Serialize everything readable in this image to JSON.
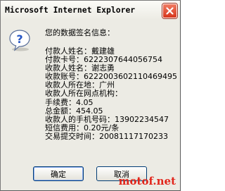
{
  "window": {
    "title": "Microsoft Internet Explorer"
  },
  "dialog": {
    "icon": "question-icon",
    "heading": "您的数据签名信息：",
    "lines": [
      "付款人姓名：戴建雄",
      "付款卡号：6222307644056754",
      "收款人姓名：谢志勇",
      "收款账号：6222003602110469495",
      "收款人所在地：广州",
      "收款人所在网点机构：",
      "手续费：4.05",
      "总金额：454.05",
      "收款人的手机号码：13902234547",
      "短信费用：0.20元/条",
      "交易提交时间：20081117170233"
    ]
  },
  "buttons": {
    "ok": "确定",
    "cancel": "取消"
  },
  "watermark": "motof.net",
  "colors": {
    "watermark": "#e1251b",
    "close_button": "#d6351b"
  }
}
